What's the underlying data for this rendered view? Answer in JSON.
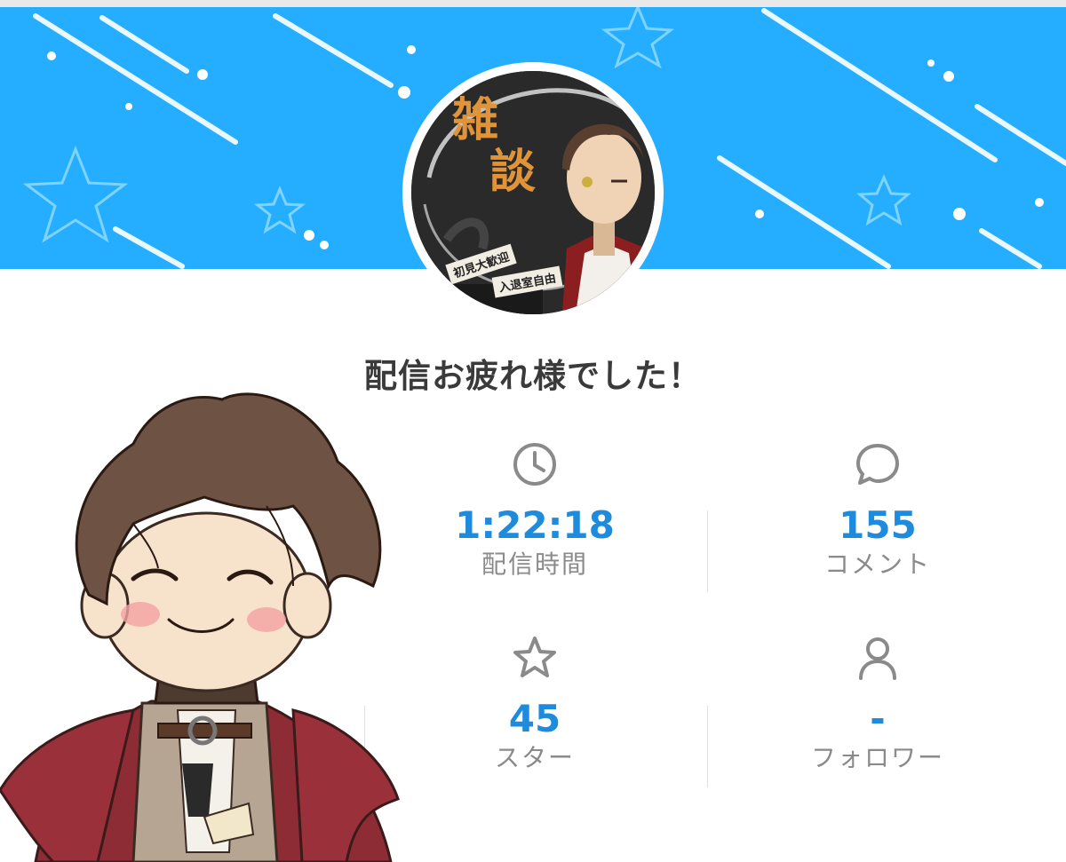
{
  "thumbnail": {
    "title_line1": "雑",
    "title_line2": "談",
    "tag_welcome": "初見大歓迎",
    "tag_free": "入退室自由"
  },
  "headline": "配信お疲れ様でした！",
  "stats": {
    "duration": {
      "icon": "clock-icon",
      "value": "1:22:18",
      "label": "配信時間"
    },
    "comments": {
      "icon": "comment-icon",
      "value": "155",
      "label": "コメント"
    },
    "stars": {
      "icon": "star-icon",
      "value": "45",
      "label": "スター"
    },
    "followers": {
      "icon": "person-icon",
      "value": "-",
      "label": "フォロワー"
    }
  },
  "colors": {
    "banner": "#25aeff",
    "accent": "#1f8bdc",
    "label": "#8a8a8a"
  }
}
